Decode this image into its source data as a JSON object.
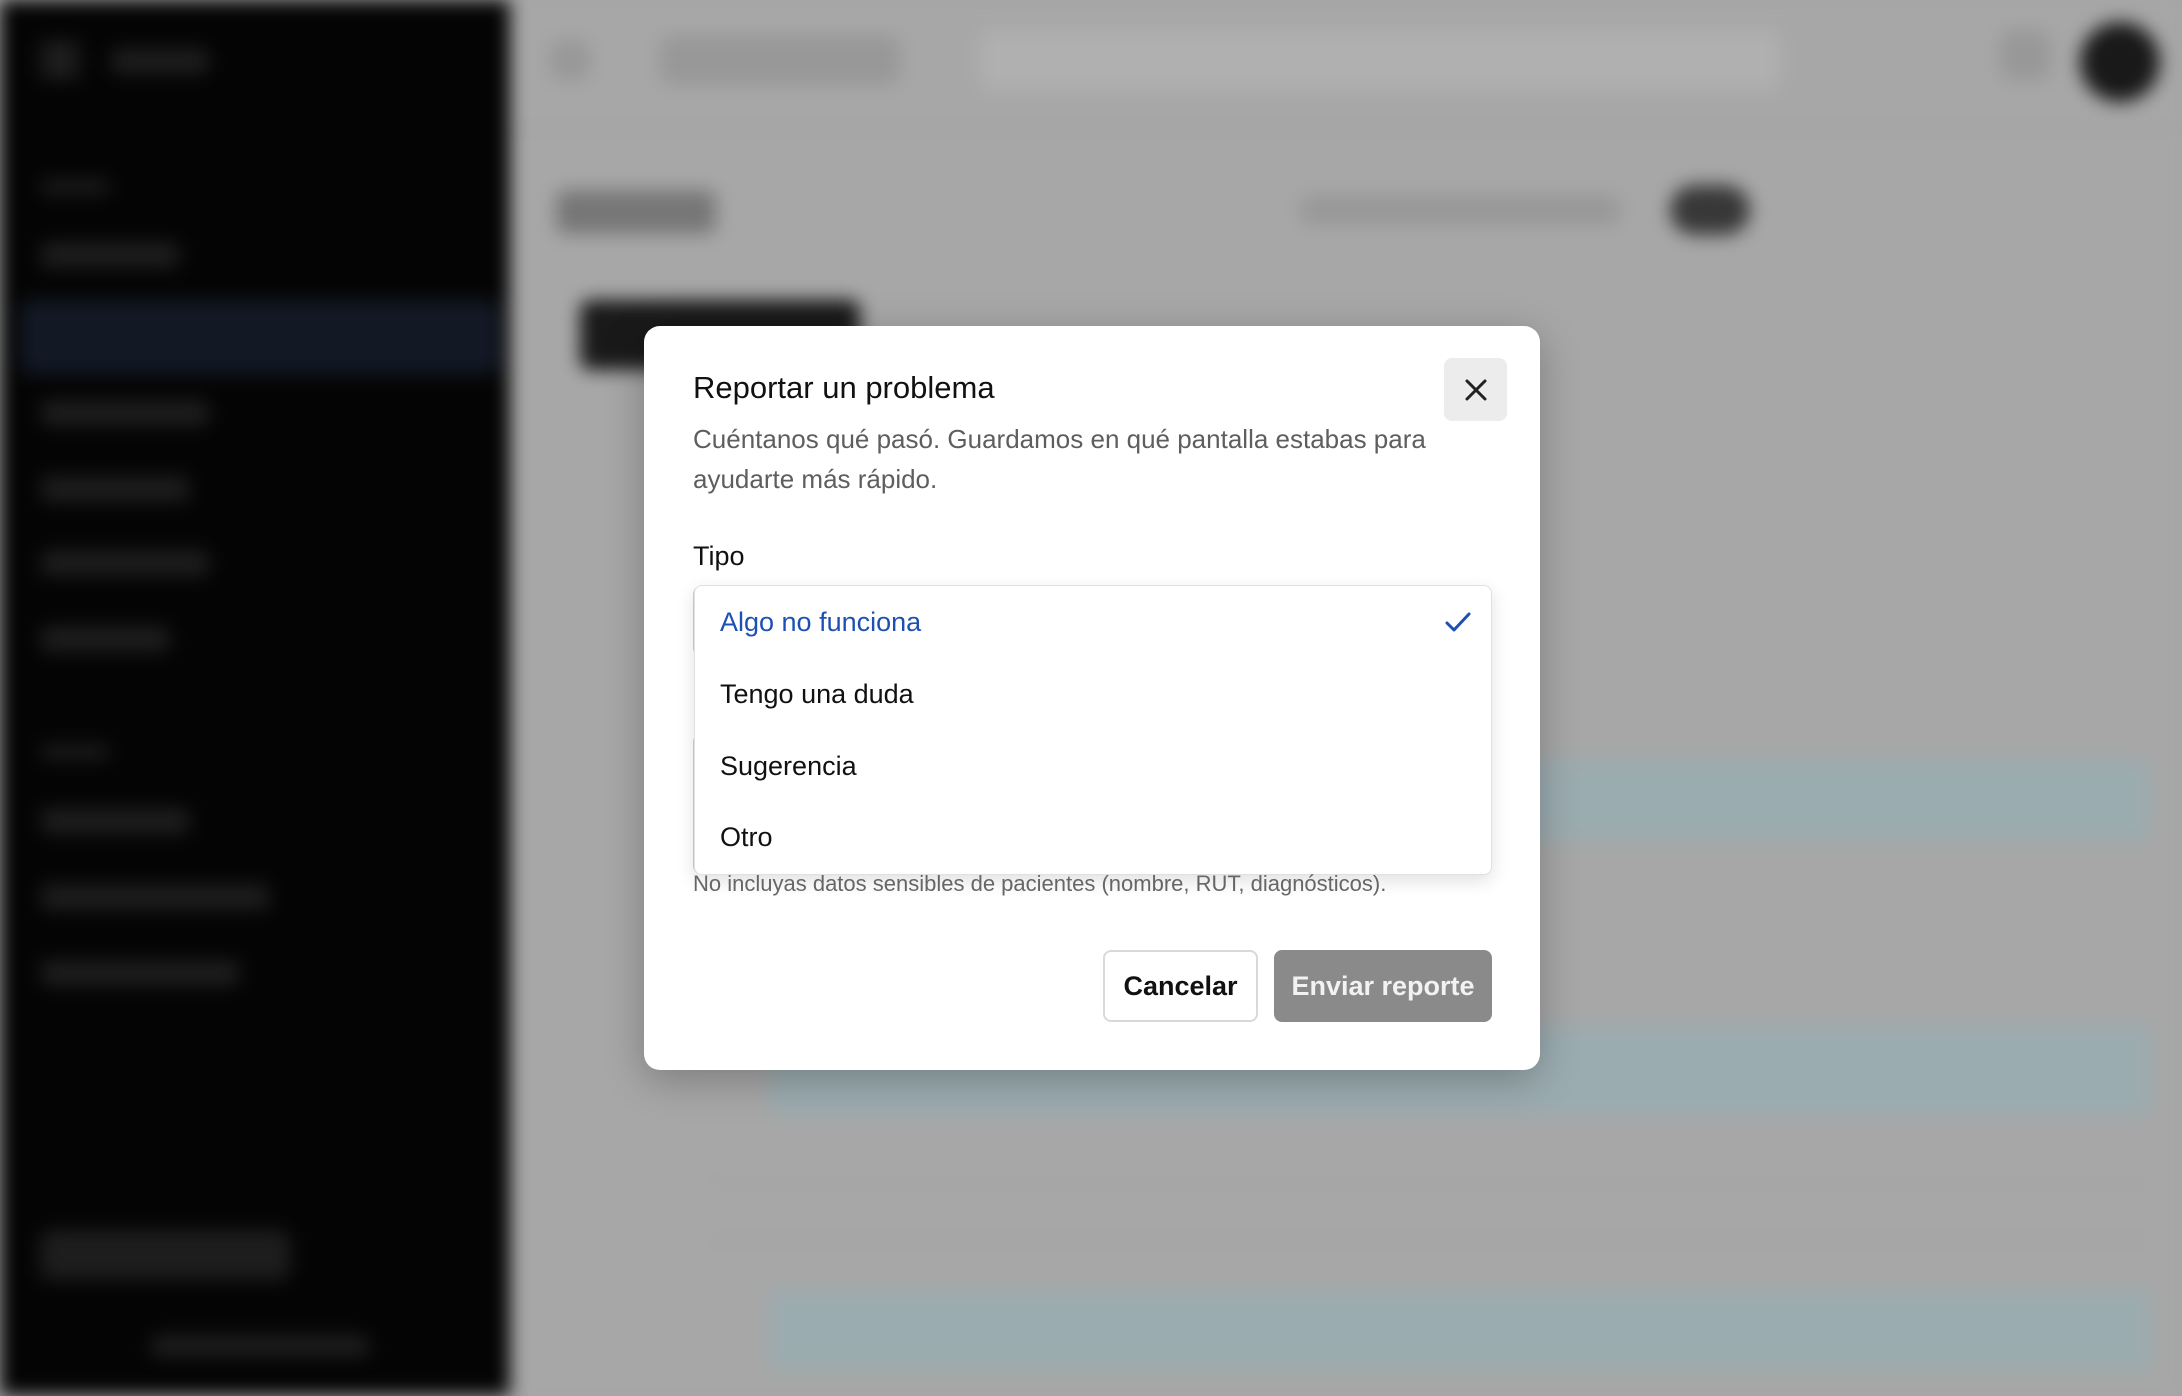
{
  "dialog": {
    "title": "Reportar un problema",
    "description": "Cuéntanos qué pasó. Guardamos en qué pantalla estabas para ayudarte más rápido.",
    "close_icon": "close-icon",
    "type_field": {
      "label": "Tipo",
      "selected": "Algo no funciona",
      "options": [
        {
          "label": "Algo no funciona",
          "selected": true
        },
        {
          "label": "Tengo una duda",
          "selected": false
        },
        {
          "label": "Sugerencia",
          "selected": false
        },
        {
          "label": "Otro",
          "selected": false
        }
      ]
    },
    "hint": "No incluyas datos sensibles de pacientes (nombre, RUT, diagnósticos).",
    "cancel_label": "Cancelar",
    "submit_label": "Enviar reporte"
  },
  "colors": {
    "accent": "#1e50b4",
    "submit_disabled": "#8a8a8a",
    "sidebar": "#050505"
  }
}
